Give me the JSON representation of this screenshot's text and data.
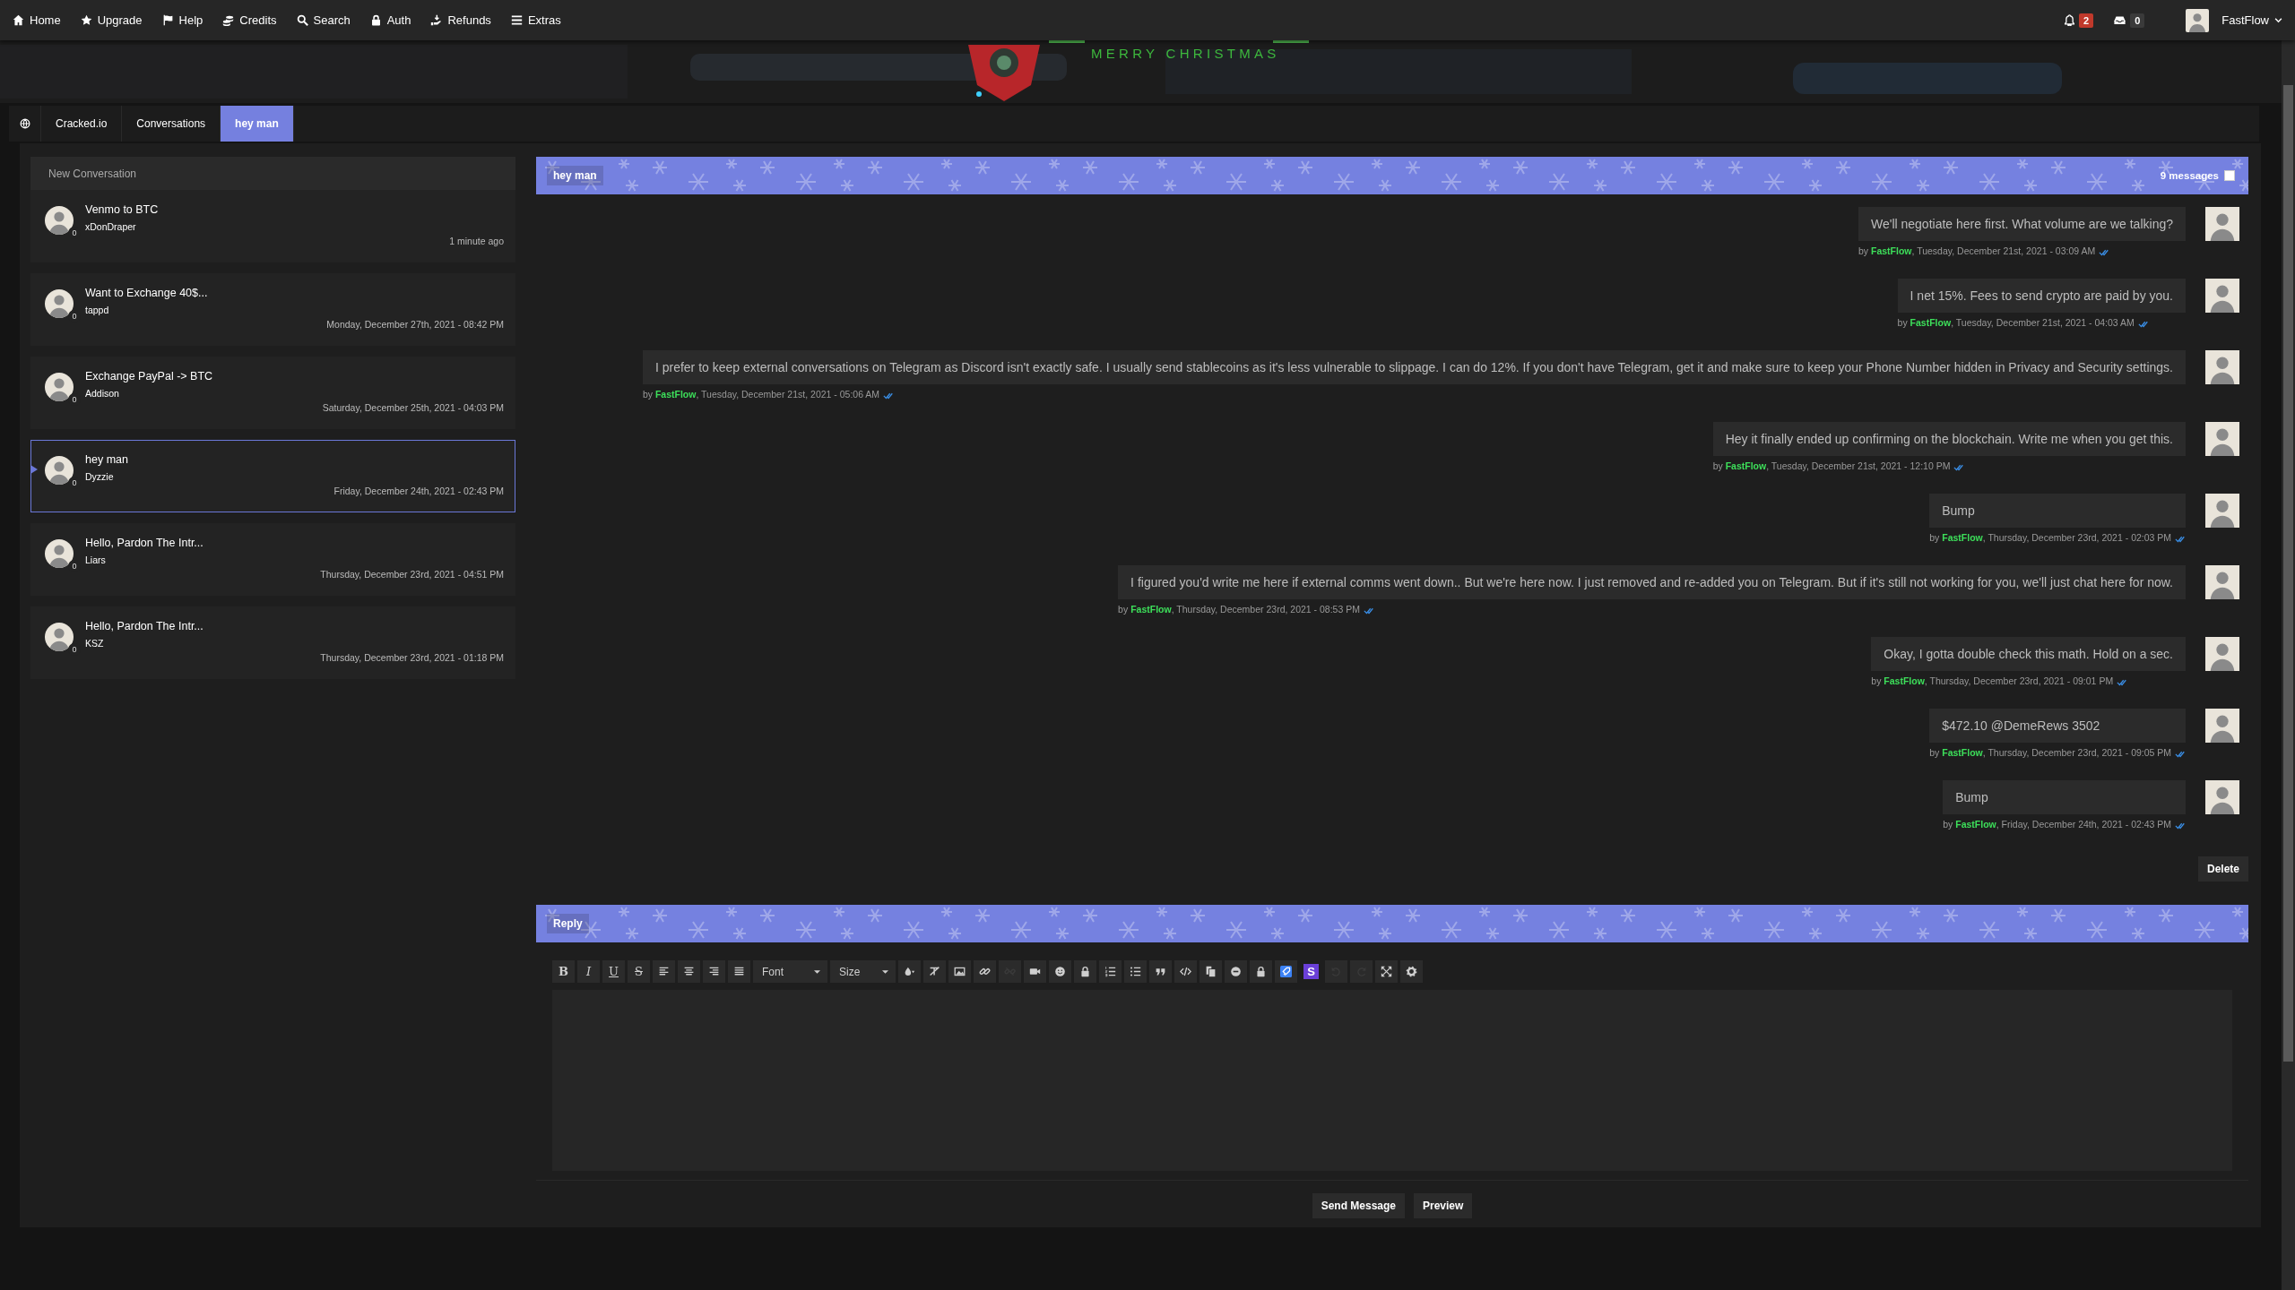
{
  "nav": {
    "items": [
      {
        "label": "Home"
      },
      {
        "label": "Upgrade"
      },
      {
        "label": "Help"
      },
      {
        "label": "Credits"
      },
      {
        "label": "Search"
      },
      {
        "label": "Auth"
      },
      {
        "label": "Refunds"
      },
      {
        "label": "Extras"
      }
    ],
    "notifications": {
      "count": "2"
    },
    "inbox": {
      "count": "0"
    },
    "user": {
      "name": "FastFlow"
    }
  },
  "banner": {
    "text": "MERRY CHRISTMAS"
  },
  "breadcrumbs": [
    {
      "label": "Cracked.io",
      "selected": false
    },
    {
      "label": "Conversations",
      "selected": false
    },
    {
      "label": "hey man",
      "selected": true
    }
  ],
  "sidebar": {
    "new_button": "New Conversation",
    "conversations": [
      {
        "title": "Venmo to BTC",
        "user": "xDonDraper",
        "time": "1 minute ago",
        "unread": "0",
        "selected": false
      },
      {
        "title": "Want to Exchange 40$...",
        "user": "tappd",
        "time": "Monday, December 27th, 2021 - 08:42 PM",
        "unread": "0",
        "selected": false
      },
      {
        "title": "Exchange PayPal -> BTC",
        "user": "Addison",
        "time": "Saturday, December 25th, 2021 - 04:03 PM",
        "unread": "0",
        "selected": false
      },
      {
        "title": "hey man",
        "user": "Dyzzie",
        "time": "Friday, December 24th, 2021 - 02:43 PM",
        "unread": "0",
        "selected": true
      },
      {
        "title": "Hello, Pardon The Intr...",
        "user": "Liars",
        "time": "Thursday, December 23rd, 2021 - 04:51 PM",
        "unread": "0",
        "selected": false
      },
      {
        "title": "Hello, Pardon The Intr...",
        "user": "KSZ",
        "time": "Thursday, December 23rd, 2021 - 01:18 PM",
        "unread": "0",
        "selected": false
      }
    ]
  },
  "thread": {
    "title": "hey man",
    "count": "9 messages",
    "select_all": false,
    "messages": [
      {
        "text": "We'll negotiate here first. What volume are we talking?",
        "prefix": "by",
        "author": "FastFlow",
        "date": ", Tuesday, December 21st, 2021 - 03:09 AM",
        "read": true
      },
      {
        "text": "I net 15%. Fees to send crypto are paid by you.",
        "prefix": "by",
        "author": "FastFlow",
        "date": ", Tuesday, December 21st, 2021 - 04:03 AM",
        "read": true
      },
      {
        "text": "I prefer to keep external conversations on Telegram as Discord isn't exactly safe. I usually send stablecoins as it's less vulnerable to slippage. I can do 12%. If you don't have Telegram, get it and make sure to keep your Phone Number hidden in Privacy and Security settings.",
        "prefix": "by",
        "author": "FastFlow",
        "date": ", Tuesday, December 21st, 2021 - 05:06 AM",
        "read": true
      },
      {
        "text": "Hey it finally ended up confirming on the blockchain. Write me when you get this.",
        "prefix": "by",
        "author": "FastFlow",
        "date": ", Tuesday, December 21st, 2021 - 12:10 PM",
        "read": true
      },
      {
        "text": "Bump",
        "prefix": "by",
        "author": "FastFlow",
        "date": ", Thursday, December 23rd, 2021 - 02:03 PM",
        "read": true
      },
      {
        "text": "I figured you'd write me here if external comms went down.. But we're here now. I just removed and re-added you on Telegram. But if it's still not working for you, we'll just chat here for now.",
        "prefix": "by",
        "author": "FastFlow",
        "date": ", Thursday, December 23rd, 2021 - 08:53 PM",
        "read": true
      },
      {
        "text": "Okay, I gotta double check this math. Hold on a sec.",
        "prefix": "by",
        "author": "FastFlow",
        "date": ", Thursday, December 23rd, 2021 - 09:01 PM",
        "read": true
      },
      {
        "text": "$472.10 @DemeRews 3502",
        "prefix": "by",
        "author": "FastFlow",
        "date": ", Thursday, December 23rd, 2021 - 09:05 PM",
        "read": true
      },
      {
        "text": "Bump",
        "prefix": "by",
        "author": "FastFlow",
        "date": ", Friday, December 24th, 2021 - 02:43 PM",
        "read": true
      }
    ],
    "delete": "Delete"
  },
  "reply": {
    "title": "Reply",
    "toolbar": [
      {
        "kind": "glyph",
        "text": "B",
        "disabled": false
      },
      {
        "kind": "glyph",
        "text": "I",
        "disabled": false
      },
      {
        "kind": "glyph",
        "text": "U",
        "disabled": false
      },
      {
        "kind": "glyph",
        "text": "S",
        "disabled": false
      },
      {
        "kind": "icon",
        "disabled": false
      },
      {
        "kind": "icon",
        "disabled": false
      },
      {
        "kind": "icon",
        "disabled": false
      },
      {
        "kind": "icon",
        "disabled": false
      },
      {
        "kind": "select",
        "label": "Font"
      },
      {
        "kind": "select",
        "label": "Size"
      },
      {
        "kind": "icon",
        "disabled": false
      },
      {
        "kind": "icon",
        "disabled": false
      },
      {
        "kind": "icon",
        "disabled": false
      },
      {
        "kind": "icon",
        "disabled": false
      },
      {
        "kind": "icon",
        "disabled": true
      },
      {
        "kind": "icon",
        "disabled": false
      },
      {
        "kind": "icon",
        "disabled": false
      },
      {
        "kind": "icon",
        "disabled": false
      },
      {
        "kind": "icon",
        "disabled": false
      },
      {
        "kind": "icon",
        "disabled": false
      },
      {
        "kind": "icon",
        "disabled": false
      },
      {
        "kind": "icon",
        "disabled": false
      },
      {
        "kind": "icon",
        "disabled": false
      },
      {
        "kind": "icon",
        "disabled": false
      },
      {
        "kind": "icon",
        "disabled": false
      },
      {
        "kind": "icon",
        "disabled": false
      },
      {
        "kind": "glyph",
        "text": "S",
        "disabled": false
      },
      {
        "kind": "icon",
        "disabled": true
      },
      {
        "kind": "icon",
        "disabled": true
      },
      {
        "kind": "icon",
        "disabled": false
      },
      {
        "kind": "icon",
        "disabled": false
      }
    ],
    "buttons": [
      "Send Message",
      "Preview"
    ]
  }
}
